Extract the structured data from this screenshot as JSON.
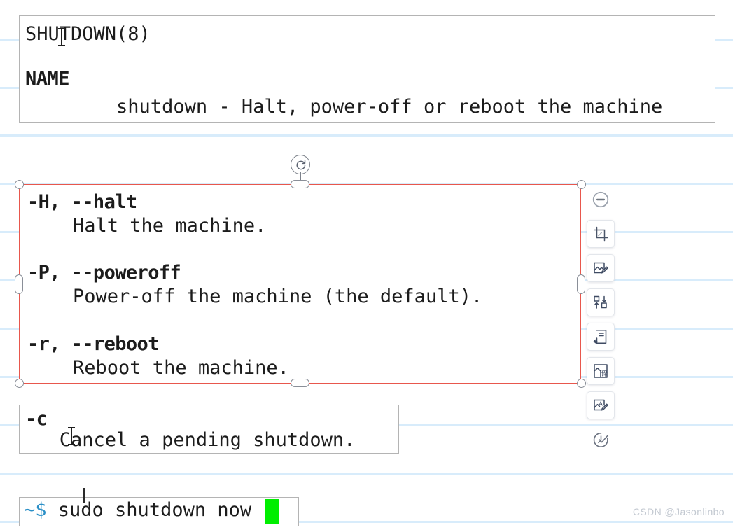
{
  "page": {
    "background_color": "#ffffff",
    "rule_line_color": "#d8ecfb",
    "rule_line_positions": [
      55,
      124,
      192,
      261,
      330,
      399,
      468,
      537,
      606,
      675,
      744
    ]
  },
  "name_block": {
    "title": "SHUTDOWN(8)",
    "section_heading": "NAME",
    "description": "        shutdown - Halt, power-off or reboot the machine"
  },
  "options_block": {
    "selected": true,
    "border_color": "#e8574d",
    "rows": [
      {
        "term": "-H, --halt",
        "desc": "    Halt the machine."
      },
      {
        "term": "-P, --poweroff",
        "desc": "    Power-off the machine (the default)."
      },
      {
        "term": "-r, --reboot",
        "desc": "    Reboot the machine."
      }
    ],
    "term_1": "-H, --halt",
    "desc_1": "    Halt the machine.",
    "term_2": "-P, --poweroff",
    "desc_2": "    Power-off the machine (the default).",
    "term_3": "-r, --reboot",
    "desc_3": "    Reboot the machine."
  },
  "cancel_block": {
    "term": "-c",
    "desc": "   Cancel a pending shutdown."
  },
  "terminal_block": {
    "prompt": "~$",
    "command": " sudo shutdown now",
    "cursor_color": "#00ee00"
  },
  "selection": {
    "rotate_handle": "rotate-icon",
    "handles": [
      "top-left-corner-handle",
      "top-center-handle",
      "top-right-corner-handle",
      "left-middle-handle",
      "right-middle-handle",
      "bottom-left-corner-handle",
      "bottom-center-handle",
      "bottom-right-corner-handle"
    ]
  },
  "toolbar": {
    "items": [
      {
        "name": "collapse-toolbar-button",
        "icon": "minus-circle-icon",
        "label": "Collapse"
      },
      {
        "name": "crop-button",
        "icon": "crop-icon",
        "label": "Crop"
      },
      {
        "name": "image-edit-button",
        "icon": "image-pencil-icon",
        "label": "Edit image"
      },
      {
        "name": "convert-button",
        "icon": "swap-squares-icon",
        "label": "Convert"
      },
      {
        "name": "extract-text-button",
        "icon": "document-extract-icon",
        "label": "Extract text"
      },
      {
        "name": "translate-button",
        "icon": "translate-icon",
        "label": "Translate"
      },
      {
        "name": "annotate-button",
        "icon": "image-text-pencil-icon",
        "label": "Annotate"
      },
      {
        "name": "history-button",
        "icon": "clock-check-icon",
        "label": "History"
      }
    ]
  },
  "watermark": {
    "text": "CSDN @Jasonlinbo"
  }
}
